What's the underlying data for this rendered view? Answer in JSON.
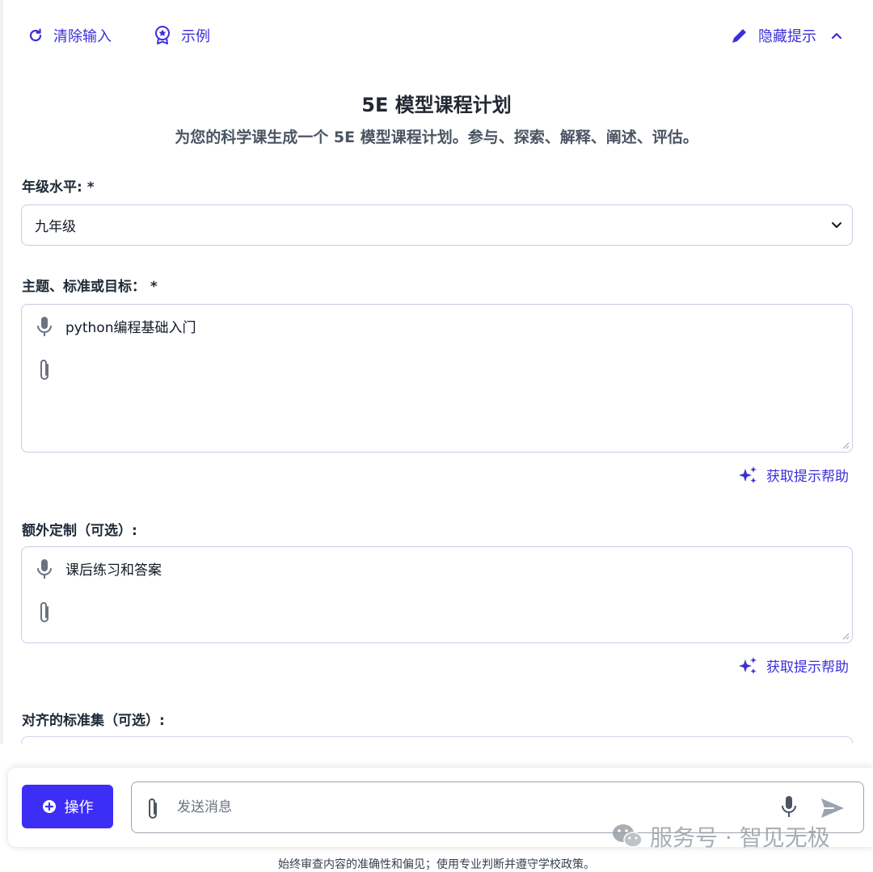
{
  "toolbar": {
    "clear_label": "清除输入",
    "examples_label": "示例",
    "hide_hints_label": "隐藏提示"
  },
  "header": {
    "title": "5E 模型课程计划",
    "subtitle": "为您的科学课生成一个 5E 模型课程计划。参与、探索、解释、阐述、评估。"
  },
  "form": {
    "grade": {
      "label": "年级水平: *",
      "value": "九年级"
    },
    "topic": {
      "label": "主题、标准或目标： *",
      "value": "python编程基础入门"
    },
    "customization": {
      "label": "额外定制（可选）:",
      "value": "课后练习和答案"
    },
    "standards": {
      "label": "对齐的标准集（可选）:"
    },
    "help_label": "获取提示帮助"
  },
  "bottom_bar": {
    "action_label": "操作",
    "message_placeholder": "发送消息"
  },
  "watermark": {
    "text": "服务号 · 智见无极"
  },
  "disclaimer": "始终审查内容的准确性和偏见；使用专业判断并遵守学校政策。",
  "colors": {
    "accent": "#3d2ef5",
    "link": "#3b2fd9",
    "border": "#c7cbe8"
  },
  "icons": [
    "refresh-icon",
    "award-icon",
    "pencil-icon",
    "chevron-up-icon",
    "chevron-down-icon",
    "microphone-icon",
    "paperclip-icon",
    "sparkles-icon",
    "plus-circle-icon",
    "send-icon",
    "wechat-icon"
  ]
}
